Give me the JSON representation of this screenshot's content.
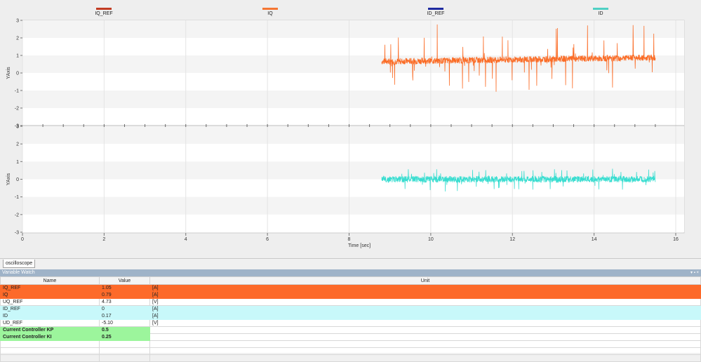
{
  "legend": [
    {
      "label": "IQ_REF",
      "color": "#c23b22"
    },
    {
      "label": "IQ",
      "color": "#f57633"
    },
    {
      "label": "ID_REF",
      "color": "#1f2aa0"
    },
    {
      "label": "ID",
      "color": "#4fd0c4"
    }
  ],
  "chart_data": [
    {
      "type": "line",
      "ylabel": "YAxis",
      "xlabel": "",
      "ylim": [
        -3,
        3
      ],
      "yticks": [
        "3",
        "2",
        "1",
        "0",
        "-1",
        "-2",
        "-3"
      ],
      "series": [
        {
          "name": "IQ",
          "color": "#fb6c26",
          "x_start": 8.8,
          "x_end": 15.5,
          "mean_start": 0.65,
          "mean_end": 0.88,
          "noise": 0.18,
          "max": 2.8,
          "min": -1.1
        }
      ]
    },
    {
      "type": "line",
      "ylabel": "YAxis",
      "xlabel": "Time [sec]",
      "ylim": [
        -3,
        3
      ],
      "xlim": [
        0,
        16
      ],
      "xticks": [
        "0",
        "2",
        "4",
        "6",
        "8",
        "10",
        "12",
        "14",
        "16"
      ],
      "yticks": [
        "3",
        "2",
        "1",
        "0",
        "-1",
        "-2",
        "-3"
      ],
      "series": [
        {
          "name": "ID",
          "color": "#38ddd0",
          "x_start": 8.8,
          "x_end": 15.5,
          "mean_start": 0.0,
          "mean_end": 0.0,
          "noise": 0.18,
          "max": 0.6,
          "min": -0.7
        }
      ]
    }
  ],
  "tab": {
    "label": "oscilloscope"
  },
  "watch": {
    "title": "Variable Watch",
    "controls": "▾ ▪ ×",
    "columns": {
      "name": "Name",
      "value": "Value",
      "unit": "Unit"
    },
    "rows": [
      {
        "name": "IQ_REF",
        "value": "1.05",
        "unit": "[A]",
        "style": "orange"
      },
      {
        "name": "IQ",
        "value": "0.79",
        "unit": "[A]",
        "style": "orange"
      },
      {
        "name": "UQ_REF",
        "value": "4.73",
        "unit": "[V]",
        "style": ""
      },
      {
        "name": "ID_REF",
        "value": "0",
        "unit": "[A]",
        "style": "cyan"
      },
      {
        "name": "ID",
        "value": "0.17",
        "unit": "[A]",
        "style": "cyan"
      },
      {
        "name": "UD_REF",
        "value": "-5.10",
        "unit": "[V]",
        "style": ""
      },
      {
        "name": "Current Controller KP",
        "value": "0.5",
        "unit": "",
        "style": "green"
      },
      {
        "name": "Current Controller KI",
        "value": "0.25",
        "unit": "",
        "style": "green"
      }
    ]
  }
}
